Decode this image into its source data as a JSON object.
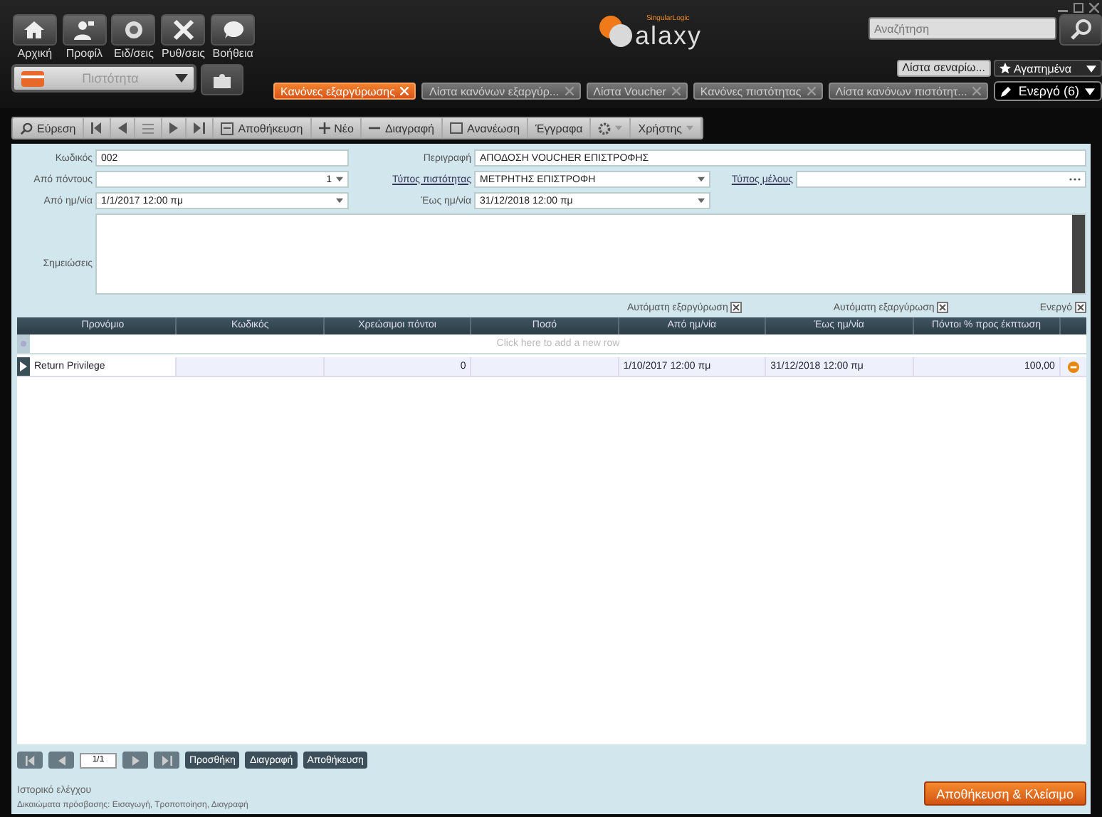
{
  "nav_buttons": [
    {
      "label": "Αρχική",
      "kind": "home"
    },
    {
      "label": "Προφίλ",
      "kind": "profile"
    },
    {
      "label": "Ειδ/σεις",
      "kind": "notifications"
    },
    {
      "label": "Ρυθ/σεις",
      "kind": "tools"
    },
    {
      "label": "Βοήθεια",
      "kind": "help"
    }
  ],
  "context_select": {
    "value": "Πιστότητα"
  },
  "logo": {
    "tagline": "SingularLogic",
    "name": "alaxy"
  },
  "search": {
    "placeholder": "Αναζήτηση"
  },
  "scenario_button": "Λίστα σεναρίω...",
  "favorites": "Αγαπημένα",
  "tabs": [
    {
      "label": "Κανόνες εξαργύρωσης",
      "selected": true
    },
    {
      "label": "Λίστα κανόνων εξαργύρ...",
      "selected": false
    },
    {
      "label": "Λίστα Voucher",
      "selected": false
    },
    {
      "label": "Κανόνες πιστότητας",
      "selected": false
    },
    {
      "label": "Λίστα κανόνων πιστότητ...",
      "selected": false
    }
  ],
  "active_menu": "Ενεργό (6)",
  "toolbar": [
    {
      "kind": "search",
      "label": "Εύρεση"
    },
    {
      "kind": "first"
    },
    {
      "kind": "prev"
    },
    {
      "kind": "list"
    },
    {
      "kind": "next"
    },
    {
      "kind": "last"
    },
    {
      "kind": "save",
      "label": "Αποθήκευση"
    },
    {
      "kind": "new",
      "label": "Νέο"
    },
    {
      "kind": "delete",
      "label": "Διαγραφή"
    },
    {
      "kind": "refresh",
      "label": "Ανανέωση"
    },
    {
      "kind": "text",
      "label": "Έγγραφα"
    },
    {
      "kind": "gear"
    },
    {
      "kind": "menu",
      "label": "Χρήστης"
    }
  ],
  "form": {
    "code": {
      "label": "Κωδικός",
      "value": "002"
    },
    "description": {
      "label": "Περιγραφή",
      "value": "ΑΠΟΔΟΣΗ VOUCHER ΕΠΙΣΤΡΟΦΗΣ"
    },
    "from_points": {
      "label": "Από πόντους",
      "value": "1"
    },
    "loyalty_type": {
      "label": "Τύπος πιστότητας",
      "value": "ΜΕΤΡΗΤΗΣ ΕΠΙΣΤΡΟΦΗ"
    },
    "member_type": {
      "label": "Τύπος μέλους"
    },
    "from_date": {
      "label": "Από ημ/νία",
      "value": "1/1/2017 12:00 πμ"
    },
    "to_date": {
      "label": "Έως ημ/νία",
      "value": "31/12/2018 12:00 πμ"
    },
    "notes": {
      "label": "Σημειώσεις"
    }
  },
  "checkboxes": [
    {
      "label": "Αυτόματη εξαργύρωση",
      "checked": true
    },
    {
      "label": "Αυτόματη εξαργύρωση",
      "checked": true
    },
    {
      "label": "Ενεργό",
      "checked": true
    }
  ],
  "table": {
    "columns": [
      "Προνόμιο",
      "Κωδικός",
      "Χρεώσιμοι πόντοι",
      "Ποσό",
      "Από ημ/νία",
      "Έως ημ/νία",
      "Πόντοι % προς έκπτωση"
    ],
    "new_row_placeholder": "Click here to add a new row",
    "rows": [
      {
        "selected": true,
        "cells": [
          "Return Privilege",
          "",
          "0",
          "",
          "1/10/2017 12:00 πμ",
          "31/12/2018 12:00 πμ",
          "100,00"
        ]
      }
    ]
  },
  "pager": {
    "page": "1/1",
    "buttons": [
      "Προσθήκη",
      "Διαγραφή",
      "Αποθήκευση"
    ]
  },
  "footer": {
    "audit": "Ιστορικό ελέγχου",
    "permissions": "Δικαιώματα πρόσβασης: Εισαγωγή, Τροποποίηση, Διαγραφή",
    "save_close": "Αποθήκευση & Κλείσιμο"
  }
}
